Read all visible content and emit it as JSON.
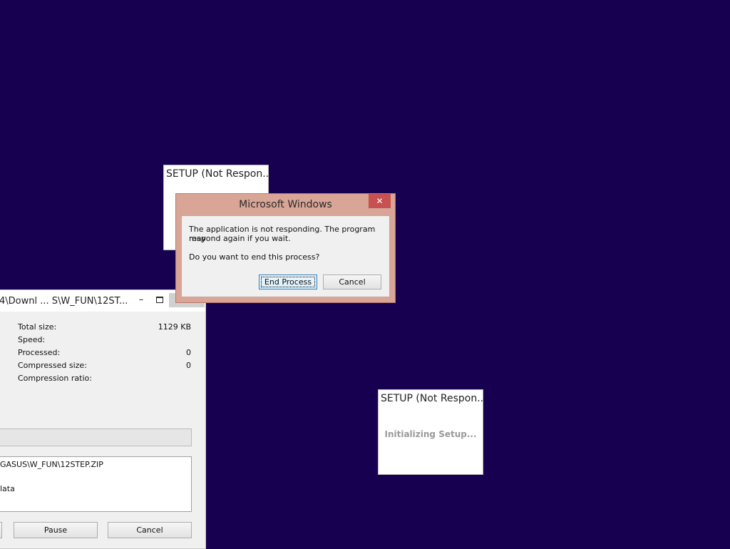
{
  "desktop": {
    "background": "#180050"
  },
  "setup_window_top": {
    "title": "SETUP (Not Respon..."
  },
  "setup_window_bottom": {
    "title": "SETUP (Not Respon...",
    "message": "Initializing Setup..."
  },
  "zip_window": {
    "title": "4\\Downl ... S\\W_FUN\\12ST...",
    "minimize_icon": "minimize-icon",
    "maximize_icon": "maximize-icon",
    "stats": [
      {
        "label": "Total size:",
        "value": "1129 KB"
      },
      {
        "label": "Speed:",
        "value": ""
      },
      {
        "label": "Processed:",
        "value": "0"
      },
      {
        "label": "Compressed size:",
        "value": "0"
      },
      {
        "label": "Compression ratio:",
        "value": ""
      }
    ],
    "progress_fraction": 0,
    "log_lines": [
      "GASUS\\W_FUN\\12STEP.ZIP",
      "lata"
    ],
    "buttons": {
      "pause": "Pause",
      "cancel": "Cancel"
    }
  },
  "dialog": {
    "title": "Microsoft Windows",
    "close_icon": "close-icon",
    "message_line1": "The application is not responding. The program may",
    "message_line2": "respond again if you wait.",
    "question": "Do you want to end this process?",
    "buttons": {
      "end_process": "End Process",
      "cancel": "Cancel"
    },
    "colors": {
      "frame": "#d9a597",
      "close": "#c75050"
    }
  }
}
